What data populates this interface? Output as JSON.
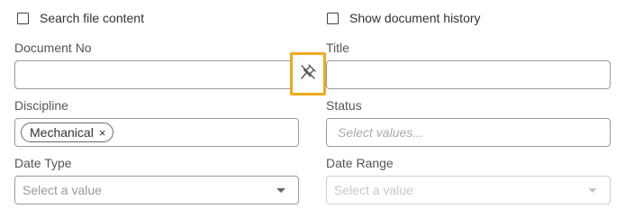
{
  "options": {
    "search_file_content": "Search file content",
    "show_document_history": "Show document history"
  },
  "fields": {
    "document_no": {
      "label": "Document No",
      "value": ""
    },
    "title": {
      "label": "Title",
      "value": ""
    },
    "discipline": {
      "label": "Discipline",
      "chips": [
        "Mechanical"
      ],
      "remove_glyph": "×"
    },
    "status": {
      "label": "Status",
      "placeholder": "Select values..."
    },
    "date_type": {
      "label": "Date Type",
      "placeholder": "Select a value"
    },
    "date_range": {
      "label": "Date Range",
      "placeholder": "Select a value"
    }
  },
  "icons": {
    "unpin": "pin-off-icon"
  },
  "colors": {
    "highlight_border": "#f0a91e"
  }
}
